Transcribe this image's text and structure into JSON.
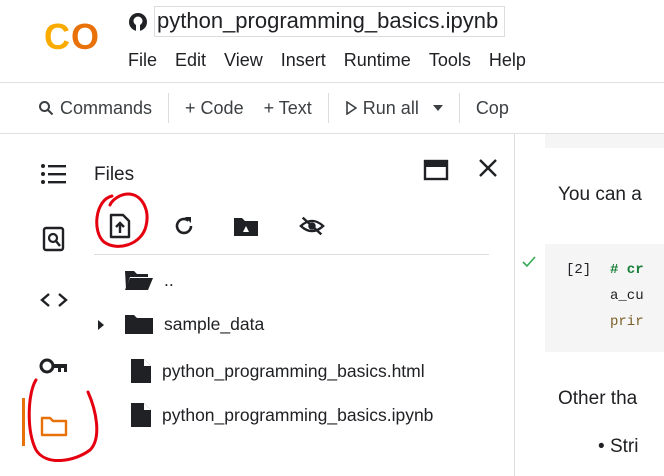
{
  "app": {
    "notebook_title": "python_programming_basics.ipynb",
    "logo_text": "CO",
    "accent": "#e8710a"
  },
  "menu": [
    "File",
    "Edit",
    "View",
    "Insert",
    "Runtime",
    "Tools",
    "Help"
  ],
  "toolbar": {
    "commands": "Commands",
    "code": "+ Code",
    "text": "+ Text",
    "run_all": "Run all",
    "copy": "Cop"
  },
  "files": {
    "title": "Files",
    "actions": [
      "upload-icon",
      "refresh-icon",
      "drive-icon",
      "hide-icon"
    ],
    "items": [
      {
        "name": "..",
        "type": "folder-open"
      },
      {
        "name": "sample_data",
        "type": "folder"
      },
      {
        "name": "python_programming_basics.html",
        "type": "file"
      },
      {
        "name": "python_programming_basics.ipynb",
        "type": "file"
      }
    ]
  },
  "notebook": {
    "text1": "You can a",
    "cell_index": "[2]",
    "code_lines": [
      "# cr",
      "a_cu",
      "prir"
    ],
    "text2": "Other tha",
    "bullet": "Stri"
  },
  "colors": {
    "icon": "#202124",
    "annotation": "#e4000f",
    "code_comment": "#188038",
    "check": "#34a853"
  }
}
